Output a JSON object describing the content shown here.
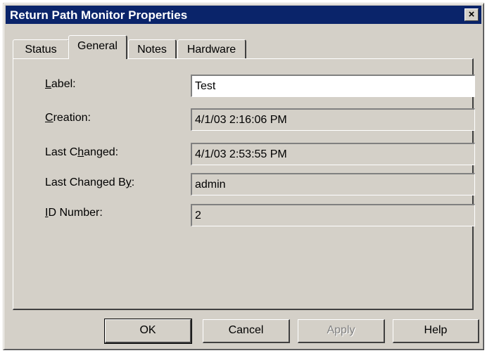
{
  "window": {
    "title": "Return Path Monitor Properties",
    "close_glyph": "×"
  },
  "tabs": [
    {
      "label": "Status",
      "active": false
    },
    {
      "label": "General",
      "active": true
    },
    {
      "label": "Notes",
      "active": false
    },
    {
      "label": "Hardware",
      "active": false
    }
  ],
  "fields": [
    {
      "prefix": "",
      "accel": "L",
      "rest": "abel:",
      "value": "Test",
      "editable": true
    },
    {
      "prefix": "",
      "accel": "C",
      "rest": "reation:",
      "value": "4/1/03 2:16:06 PM",
      "editable": false
    },
    {
      "prefix": "Last C",
      "accel": "h",
      "rest": "anged:",
      "value": "4/1/03 2:53:55 PM",
      "editable": false
    },
    {
      "prefix": "Last Changed B",
      "accel": "y",
      "rest": ":",
      "value": "admin",
      "editable": false
    },
    {
      "prefix": "",
      "accel": "I",
      "rest": "D Number:",
      "value": "2",
      "editable": false
    }
  ],
  "buttons": {
    "ok": "OK",
    "cancel": "Cancel",
    "apply": "Apply",
    "help": "Help"
  }
}
